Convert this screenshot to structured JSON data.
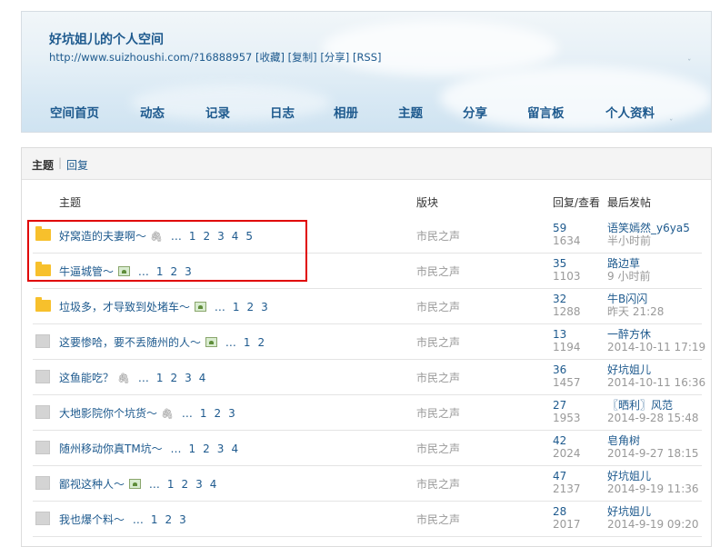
{
  "header": {
    "title": "好坑姐儿的个人空间",
    "url": "http://www.suizhoushi.com/?16888957",
    "url_links": [
      "[收藏]",
      "[复制]",
      "[分享]",
      "[RSS]"
    ]
  },
  "nav": [
    "空间首页",
    "动态",
    "记录",
    "日志",
    "相册",
    "主题",
    "分享",
    "留言板",
    "个人资料"
  ],
  "tabs": {
    "active": "主题",
    "other": "回复"
  },
  "columns": {
    "topic": "主题",
    "forum": "版块",
    "stats": "回复/查看",
    "last": "最后发帖"
  },
  "threads": [
    {
      "title": "好窝造的夫妻啊～",
      "attach": "clip",
      "pages": [
        "1",
        "2",
        "3",
        "4",
        "5"
      ],
      "forum": "市民之声",
      "replies": "59",
      "views": "1634",
      "user": "语笑嫣然_y6ya5",
      "time": "半小时前"
    },
    {
      "title": "牛逼城管～",
      "attach": "image",
      "pages": [
        "1",
        "2",
        "3"
      ],
      "forum": "市民之声",
      "replies": "35",
      "views": "1103",
      "user": "路边草",
      "time": "9 小时前"
    },
    {
      "title": "垃圾多，才导致到处堵车～",
      "attach": "image",
      "pages": [
        "1",
        "2",
        "3"
      ],
      "forum": "市民之声",
      "replies": "32",
      "views": "1288",
      "user": "牛B闪闪",
      "time": "昨天 21:28"
    },
    {
      "title": "这要惨哈，要不丢随州的人～",
      "attach": "image",
      "pages": [
        "1",
        "2"
      ],
      "forum": "市民之声",
      "replies": "13",
      "views": "1194",
      "user": "一醉方休",
      "time": "2014-10-11 17:19"
    },
    {
      "title": "这鱼能吃？",
      "attach": "clip",
      "pages": [
        "1",
        "2",
        "3",
        "4"
      ],
      "forum": "市民之声",
      "replies": "36",
      "views": "1457",
      "user": "好坑姐儿",
      "time": "2014-10-11 16:36"
    },
    {
      "title": "大地影院你个坑货～",
      "attach": "clip",
      "pages": [
        "1",
        "2",
        "3"
      ],
      "forum": "市民之声",
      "replies": "27",
      "views": "1953",
      "user": "〖晒利〗风范",
      "time": "2014-9-28 15:48"
    },
    {
      "title": "随州移动你真TM坑～",
      "attach": "",
      "pages": [
        "1",
        "2",
        "3",
        "4"
      ],
      "forum": "市民之声",
      "replies": "42",
      "views": "2024",
      "user": "皂角树",
      "time": "2014-9-27 18:15"
    },
    {
      "title": "鄙视这种人～",
      "attach": "image",
      "pages": [
        "1",
        "2",
        "3",
        "4"
      ],
      "forum": "市民之声",
      "replies": "47",
      "views": "2137",
      "user": "好坑姐儿",
      "time": "2014-9-19 11:36"
    },
    {
      "title": "我也爆个料～",
      "attach": "",
      "pages": [
        "1",
        "2",
        "3"
      ],
      "forum": "市民之声",
      "replies": "28",
      "views": "2017",
      "user": "好坑姐儿",
      "time": "2014-9-19 09:20"
    }
  ],
  "ellipsis": "…",
  "colors": {
    "link": "#1e5a8e",
    "muted": "#999999",
    "highlight": "#e00000",
    "folder_hot": "#f7c02c"
  }
}
